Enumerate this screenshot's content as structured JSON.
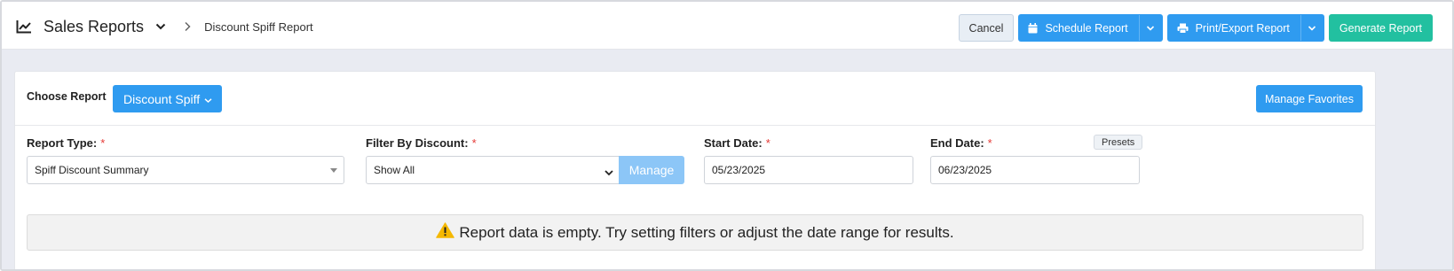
{
  "header": {
    "app_title": "Sales Reports",
    "breadcrumb_current": "Discount Spiff Report",
    "buttons": {
      "cancel": "Cancel",
      "schedule": "Schedule Report",
      "print_export": "Print/Export Report",
      "generate": "Generate Report"
    }
  },
  "report_picker": {
    "label": "Choose Report",
    "selected": "Discount Spiff",
    "manage_favorites": "Manage Favorites"
  },
  "filters": {
    "report_type": {
      "label": "Report Type:",
      "required_mark": "*",
      "value": "Spiff Discount Summary"
    },
    "filter_by_discount": {
      "label": "Filter By Discount:",
      "required_mark": "*",
      "value": "Show All",
      "manage_label": "Manage"
    },
    "start_date": {
      "label": "Start Date:",
      "required_mark": "*",
      "value": "05/23/2025"
    },
    "end_date": {
      "label": "End Date:",
      "required_mark": "*",
      "value": "06/23/2025",
      "presets_label": "Presets"
    }
  },
  "notice": {
    "icon": "warning-icon",
    "text": "Report data is empty. Try setting filters or adjust the date range for results."
  },
  "colors": {
    "primary": "#2f9bf0",
    "success": "#22c0a0",
    "manage_disabled": "#8cc6f7",
    "required": "#e53935",
    "warning": "#f5b800"
  }
}
